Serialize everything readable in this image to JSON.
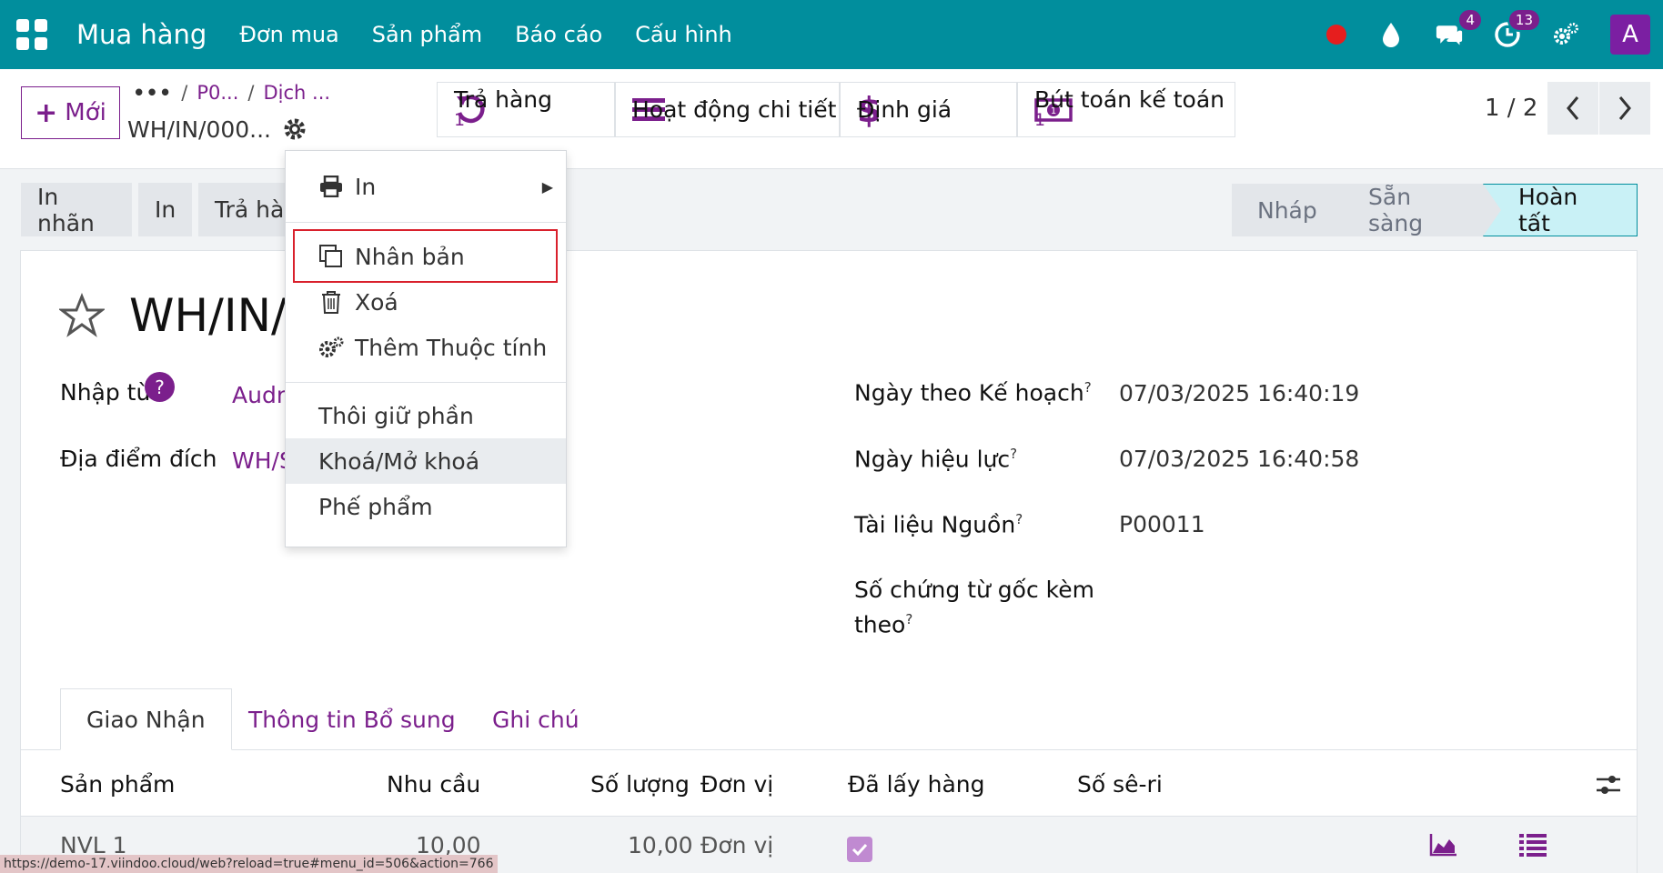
{
  "navbar": {
    "brand": "Mua hàng",
    "menu": [
      "Đơn mua",
      "Sản phẩm",
      "Báo cáo",
      "Cấu hình"
    ],
    "messages_count": "4",
    "activities_count": "13",
    "avatar_letter": "A"
  },
  "control": {
    "new_label": "Mới",
    "breadcrumb": [
      "P0...",
      "Dịch ..."
    ],
    "record_name": "WH/IN/000...",
    "smart_buttons": [
      {
        "label": "Trả hàng",
        "count": "1"
      },
      {
        "label": "Hoạt động chi tiết"
      },
      {
        "label": "Định giá"
      },
      {
        "label": "Bút toán kế toán",
        "count": "1"
      }
    ],
    "pager": "1 / 2"
  },
  "header_buttons": [
    "In nhãn",
    "In",
    "Trả hàng"
  ],
  "statusbar": [
    "Nháp",
    "Sẵn sàng",
    "Hoàn tất"
  ],
  "form": {
    "title": "WH/IN/",
    "left_fields": [
      {
        "label": "Nhập từ",
        "value": "Audr"
      },
      {
        "label": "Địa điểm đích",
        "value": "WH/S"
      }
    ],
    "right_fields": [
      {
        "label": "Ngày theo Kế hoạch",
        "value": "07/03/2025 16:40:19"
      },
      {
        "label": "Ngày hiệu lực",
        "value": "07/03/2025 16:40:58"
      },
      {
        "label": "Tài liệu Nguồn",
        "value": "P00011"
      },
      {
        "label_line1": "Số chứng từ gốc kèm",
        "label_line2": "theo",
        "value": ""
      }
    ]
  },
  "tabs": [
    "Giao Nhận",
    "Thông tin Bổ sung",
    "Ghi chú"
  ],
  "table": {
    "headers": [
      "Sản phẩm",
      "Nhu cầu",
      "Số lượng",
      "Đơn vị",
      "Đã lấy hàng",
      "Số sê-ri"
    ],
    "rows": [
      {
        "product": "NVL 1",
        "demand": "10,00",
        "quantity": "10,00",
        "uom": "Đơn vị",
        "picked": true
      }
    ]
  },
  "dropdown": {
    "items": [
      "In",
      "Nhân bản",
      "Xoá",
      "Thêm Thuộc tính",
      "Thôi giữ phần",
      "Khoá/Mở khoá",
      "Phế phẩm"
    ]
  },
  "status_url": "https://demo-17.viindoo.cloud/web?reload=true#menu_id=506&action=766",
  "colors": {
    "primary": "#018e9d",
    "accent": "#7b1f8c",
    "highlight_box": "#d9202c"
  }
}
